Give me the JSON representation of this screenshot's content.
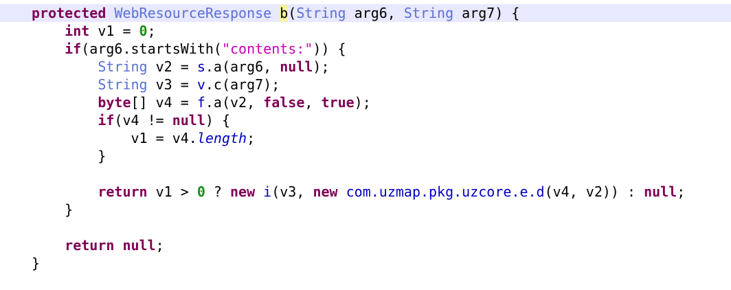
{
  "code_lines": [
    {
      "indent": "",
      "tokens": [
        {
          "t": "protected",
          "c": "kw"
        },
        {
          "t": " ",
          "c": ""
        },
        {
          "t": "WebResourceResponse",
          "c": "ty"
        },
        {
          "t": " ",
          "c": ""
        },
        {
          "t": "b",
          "c": "hl"
        },
        {
          "t": "(",
          "c": ""
        },
        {
          "t": "String",
          "c": "ty"
        },
        {
          "t": " arg6, ",
          "c": ""
        },
        {
          "t": "String",
          "c": "ty"
        },
        {
          "t": " arg7) {",
          "c": ""
        }
      ]
    },
    {
      "indent": "    ",
      "tokens": [
        {
          "t": "int",
          "c": "kw"
        },
        {
          "t": " v1 = ",
          "c": ""
        },
        {
          "t": "0",
          "c": "nm"
        },
        {
          "t": ";",
          "c": ""
        }
      ]
    },
    {
      "indent": "    ",
      "tokens": [
        {
          "t": "if",
          "c": "kw"
        },
        {
          "t": "(arg6.startsWith(",
          "c": ""
        },
        {
          "t": "\"contents:\"",
          "c": "st"
        },
        {
          "t": ")) {",
          "c": ""
        }
      ]
    },
    {
      "indent": "        ",
      "tokens": [
        {
          "t": "String",
          "c": "ty"
        },
        {
          "t": " v2 = ",
          "c": ""
        },
        {
          "t": "s",
          "c": "mc"
        },
        {
          "t": ".a(arg6, ",
          "c": ""
        },
        {
          "t": "null",
          "c": "kw"
        },
        {
          "t": ");",
          "c": ""
        }
      ]
    },
    {
      "indent": "        ",
      "tokens": [
        {
          "t": "String",
          "c": "ty"
        },
        {
          "t": " v3 = ",
          "c": ""
        },
        {
          "t": "v",
          "c": "mc"
        },
        {
          "t": ".c(arg7);",
          "c": ""
        }
      ]
    },
    {
      "indent": "        ",
      "tokens": [
        {
          "t": "byte",
          "c": "kw"
        },
        {
          "t": "[] v4 = ",
          "c": ""
        },
        {
          "t": "f",
          "c": "mc"
        },
        {
          "t": ".a(v2, ",
          "c": ""
        },
        {
          "t": "false",
          "c": "kw"
        },
        {
          "t": ", ",
          "c": ""
        },
        {
          "t": "true",
          "c": "kw"
        },
        {
          "t": ");",
          "c": ""
        }
      ]
    },
    {
      "indent": "        ",
      "tokens": [
        {
          "t": "if",
          "c": "kw"
        },
        {
          "t": "(v4 != ",
          "c": ""
        },
        {
          "t": "null",
          "c": "kw"
        },
        {
          "t": ") {",
          "c": ""
        }
      ]
    },
    {
      "indent": "            ",
      "tokens": [
        {
          "t": "v1 = v4.",
          "c": ""
        },
        {
          "t": "length",
          "c": "fd"
        },
        {
          "t": ";",
          "c": ""
        }
      ]
    },
    {
      "indent": "        ",
      "tokens": [
        {
          "t": "}",
          "c": ""
        }
      ]
    },
    {
      "indent": "",
      "tokens": []
    },
    {
      "indent": "        ",
      "tokens": [
        {
          "t": "return",
          "c": "kw"
        },
        {
          "t": " v1 > ",
          "c": ""
        },
        {
          "t": "0",
          "c": "nm"
        },
        {
          "t": " ? ",
          "c": ""
        },
        {
          "t": "new",
          "c": "kw"
        },
        {
          "t": " ",
          "c": ""
        },
        {
          "t": "i",
          "c": "mc"
        },
        {
          "t": "(v3, ",
          "c": ""
        },
        {
          "t": "new",
          "c": "kw"
        },
        {
          "t": " ",
          "c": ""
        },
        {
          "t": "com.uzmap.pkg.uzcore.e.d",
          "c": "mc"
        },
        {
          "t": "(v4, v2)) : ",
          "c": ""
        },
        {
          "t": "null",
          "c": "kw"
        },
        {
          "t": ";",
          "c": ""
        }
      ]
    },
    {
      "indent": "    ",
      "tokens": [
        {
          "t": "}",
          "c": ""
        }
      ]
    },
    {
      "indent": "",
      "tokens": []
    },
    {
      "indent": "    ",
      "tokens": [
        {
          "t": "return",
          "c": "kw"
        },
        {
          "t": " ",
          "c": ""
        },
        {
          "t": "null",
          "c": "kw"
        },
        {
          "t": ";",
          "c": ""
        }
      ]
    },
    {
      "indent": "",
      "tokens": [
        {
          "t": "}",
          "c": ""
        }
      ]
    }
  ],
  "current_line_index": 0,
  "colors": {
    "keyword": "#7f0055",
    "type": "#5a6fd6",
    "string": "#c800b4",
    "number": "#1a8f1a",
    "method": "#0000c0",
    "field": "#0000c0",
    "current_line_bg": "#e8e8ff",
    "match_highlight": "#f5f59a"
  }
}
